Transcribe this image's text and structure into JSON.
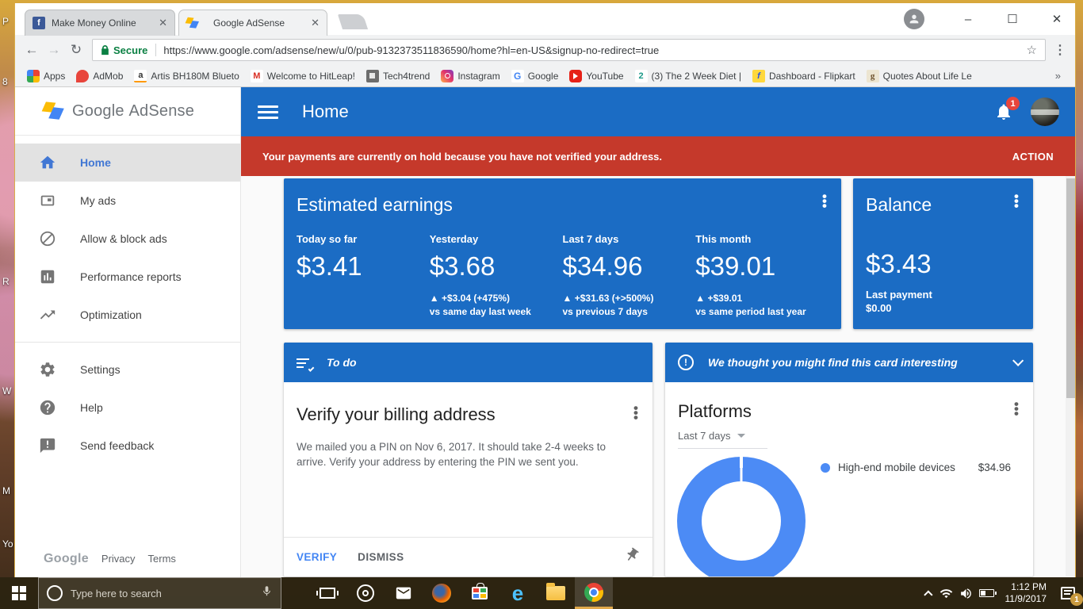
{
  "desktop": {
    "fragments": [
      {
        "text": "P",
        "y": 20
      },
      {
        "text": "8",
        "y": 96
      },
      {
        "text": "R",
        "y": 348
      },
      {
        "text": "W",
        "y": 486
      },
      {
        "text": "M",
        "y": 612
      },
      {
        "text": "Yo",
        "y": 679
      }
    ]
  },
  "browser": {
    "tabs": [
      {
        "label": "Make Money Online",
        "favicon": "facebook",
        "active": false
      },
      {
        "label": "Google AdSense",
        "favicon": "adsense",
        "active": true
      }
    ],
    "titlebar": {
      "minimize": "–",
      "maximize": "☐",
      "close": "✕"
    },
    "toolbar": {
      "back": "←",
      "forward": "→",
      "reload": "↻",
      "secure_label": "Secure",
      "url": "https://www.google.com/adsense/new/u/0/pub-9132373511836590/home?hl=en-US&signup-no-redirect=true",
      "star": "☆",
      "menu": "⋮"
    },
    "bookmarks": [
      {
        "label": "Apps"
      },
      {
        "label": "AdMob"
      },
      {
        "label": "Artis BH180M Blueto"
      },
      {
        "label": "Welcome to HitLeap!"
      },
      {
        "label": "Tech4trend"
      },
      {
        "label": "Instagram"
      },
      {
        "label": "Google"
      },
      {
        "label": "YouTube"
      },
      {
        "label": "(3) The 2 Week Diet |"
      },
      {
        "label": "Dashboard - Flipkart"
      },
      {
        "label": "Quotes About Life Le"
      }
    ],
    "bookmarks_overflow": "»"
  },
  "adsense": {
    "logo": {
      "brand": "Google",
      "product": "AdSense"
    },
    "appbar": {
      "title": "Home",
      "notification_count": "1"
    },
    "alert": {
      "message": "Your payments are currently on hold because you have not verified your address.",
      "action_label": "ACTION"
    },
    "sidebar": {
      "items": [
        {
          "label": "Home"
        },
        {
          "label": "My ads"
        },
        {
          "label": "Allow & block ads"
        },
        {
          "label": "Performance reports"
        },
        {
          "label": "Optimization"
        },
        {
          "label": "Settings"
        },
        {
          "label": "Help"
        },
        {
          "label": "Send feedback"
        }
      ],
      "footer": {
        "brand": "Google",
        "links": [
          "Privacy",
          "Terms"
        ]
      }
    },
    "earnings_card": {
      "title": "Estimated earnings",
      "columns": [
        {
          "label": "Today so far",
          "value": "$3.41",
          "delta": "",
          "vs": ""
        },
        {
          "label": "Yesterday",
          "value": "$3.68",
          "delta": "▲ +$3.04 (+475%)",
          "vs": "vs same day last week"
        },
        {
          "label": "Last 7 days",
          "value": "$34.96",
          "delta": "▲ +$31.63 (+>500%)",
          "vs": "vs previous 7 days"
        },
        {
          "label": "This month",
          "value": "$39.01",
          "delta": "▲ +$39.01",
          "vs": "vs same period last year"
        }
      ]
    },
    "balance_card": {
      "title": "Balance",
      "value": "$3.43",
      "last_payment_label": "Last payment",
      "last_payment_value": "$0.00"
    },
    "todo_card": {
      "header": "To do",
      "title": "Verify your billing address",
      "body": "We mailed you a PIN on Nov 6, 2017. It should take 2-4 weeks to arrive. Verify your address by entering the PIN we sent you.",
      "verify_label": "VERIFY",
      "dismiss_label": "DISMISS"
    },
    "interesting_card": {
      "header": "We thought you might find this card interesting",
      "title": "Platforms",
      "period": "Last 7 days",
      "legend_label": "High-end mobile devices",
      "legend_value": "$34.96"
    }
  },
  "chart_data": {
    "type": "pie",
    "donut": true,
    "title": "Platforms",
    "period": "Last 7 days",
    "series": [
      {
        "name": "High-end mobile devices",
        "value": 34.96,
        "display": "$34.96",
        "color": "#4c8bf5"
      }
    ],
    "legend_position": "right"
  },
  "taskbar": {
    "search_placeholder": "Type here to search",
    "tray": {
      "time": "1:12 PM",
      "date": "11/9/2017",
      "badge": "1"
    }
  },
  "colors": {
    "header_blue": "#1b6cc4",
    "card_blue": "#1b6cc4",
    "alert_red": "#c5392b",
    "donut_blue": "#4c8bf5",
    "link_blue": "#4285f4",
    "badge_red": "#e8453c",
    "selected_nav_blue": "#4177d4",
    "taskbar_badge": "#c99a3f"
  }
}
